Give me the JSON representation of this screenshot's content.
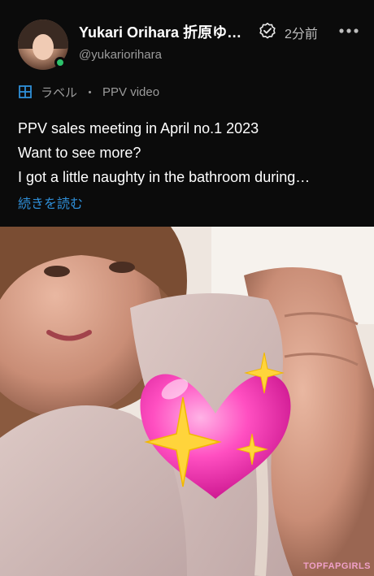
{
  "post": {
    "author": {
      "display_name": "Yukari Orihara 折原ゆ…",
      "handle": "@yukariorihara",
      "verified_icon": "verified-check-icon",
      "online_status": "online"
    },
    "timestamp": "2分前",
    "more_icon": "more-dots-icon",
    "tag": {
      "icon": "label-icon",
      "label": "ラベル",
      "separator": "・",
      "value": "PPV video"
    },
    "text_lines": [
      "PPV sales meeting in April no.1 2023",
      "Want to see more?",
      "I got a little naughty in the bathroom during…"
    ],
    "read_more": "続きを読む",
    "watermark": "TOPFAPGIRLS"
  },
  "colors": {
    "background": "#0b0b0b",
    "link": "#2f8fd8",
    "online": "#2dc26b",
    "muted": "#9b9b9b"
  }
}
